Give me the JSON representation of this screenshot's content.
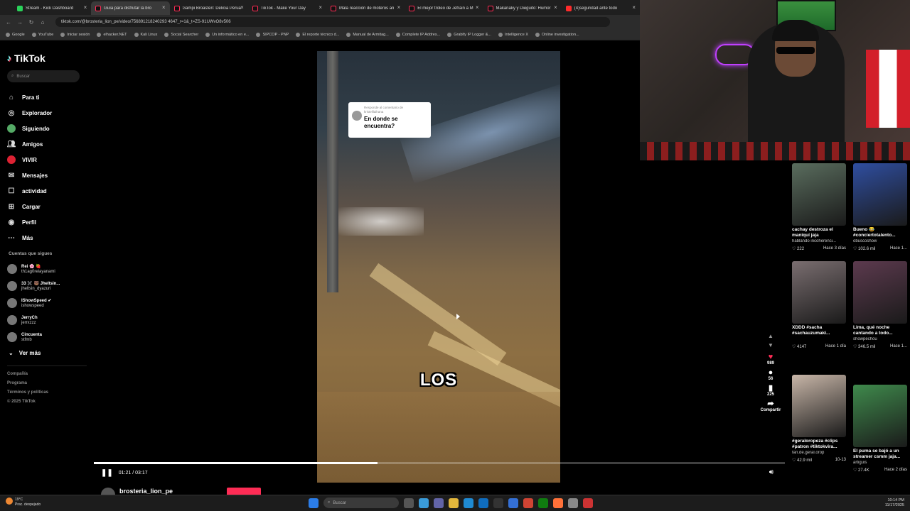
{
  "browser": {
    "tabs": [
      {
        "label": "Stream - Kick Dashboard",
        "active": false,
        "favicon": "kick"
      },
      {
        "label": "Guía para disfrutar la bro",
        "active": true,
        "favicon": "tiktok"
      },
      {
        "label": "Gampi Broasten: Delicia Perua",
        "active": false,
        "favicon": "tiktok"
      },
      {
        "label": "TikTok - Make Your Day",
        "active": false,
        "favicon": "tiktok"
      },
      {
        "label": "Mala reacción de moteros an",
        "active": false,
        "favicon": "tiktok"
      },
      {
        "label": "El mejor troleo de Jefrain a M",
        "active": false,
        "favicon": "tiktok"
      },
      {
        "label": "Makanaky y Dieguito: Humor",
        "active": false,
        "favicon": "tiktok"
      },
      {
        "label": "(4)seguridad ante todo",
        "active": false,
        "favicon": "youtube"
      }
    ],
    "url": "tiktok.com/@brosteria_lion_pe/video/756891218240293 4647_r=1&_t=ZS-91UWvO8v506",
    "bookmarks": [
      "Google",
      "YouTube",
      "Iniciar sesión",
      "elhacker.NET",
      "Kali Linux",
      "Social Searcher",
      "Un informático en e...",
      "SIPCOP - PNP",
      "El reporte técnico d...",
      "Manual de Armitag...",
      "Complete IP Addres...",
      "Grabify IP Logger &...",
      "Intelligence X",
      "Online investigation..."
    ]
  },
  "sidebar": {
    "logo": "TikTok",
    "search_placeholder": "Buscar",
    "menu": [
      {
        "label": "Para ti",
        "icon": "home-icon"
      },
      {
        "label": "Explorador",
        "icon": "compass-icon"
      },
      {
        "label": "Siguiendo",
        "icon": "following-avatar"
      },
      {
        "label": "Amigos",
        "icon": "friends-icon"
      },
      {
        "label": "VIVIR",
        "icon": "live-avatar"
      },
      {
        "label": "Mensajes",
        "icon": "message-icon"
      },
      {
        "label": "actividad",
        "icon": "activity-icon"
      },
      {
        "label": "Cargar",
        "icon": "upload-icon"
      },
      {
        "label": "Perfil",
        "icon": "profile-icon"
      },
      {
        "label": "Más",
        "icon": "more-icon"
      }
    ],
    "following_title": "Cuentas que sigues",
    "following": [
      {
        "name": "Rei 🌸 🍓",
        "handle": "th1ag0reiayanami"
      },
      {
        "name": "33 ✖️ 🐻 Jheltsin...",
        "handle": "jheltsin_dyazuri"
      },
      {
        "name": "IShowSpeed ✔",
        "handle": "ishowspeed"
      },
      {
        "name": "JerryCh",
        "handle": "jerrxzzz"
      },
      {
        "name": "Cincuenta",
        "handle": "stfmb"
      }
    ],
    "see_more": "Ver más",
    "footer": [
      "Compañía",
      "Programa",
      "Términos y políticas",
      "© 2025 TikTok"
    ]
  },
  "video": {
    "comment_reply_label": "Responde al comentario de",
    "comment_author": "kristelllaihana",
    "comment_question": "En donde se encuentra?",
    "caption": "LOS",
    "time": "01:21 / 03:17",
    "progress": 0.41,
    "author": "brosteria_lion_pe"
  },
  "actions": {
    "likes": "989",
    "comments": "56",
    "saves": "225",
    "share": "Compartir"
  },
  "recommendations": [
    {
      "title": "cachay destroza el maniquí jaja",
      "author": "hablando incoherenci...",
      "views": "222",
      "age": "Hace 3 días",
      "thumb": "#5a6d5e"
    },
    {
      "title": "Bueno 😂 #conciertotalento...",
      "author": "obuscoshow",
      "views": "102.6 mil",
      "age": "Hace 1...",
      "thumb": "#2f4ea0"
    },
    {
      "title": "XDDD #sacha #sachauzumaki...",
      "author": "",
      "views": "4147",
      "age": "Hace 1 día",
      "thumb": "#7a6e70"
    },
    {
      "title": "Lima, qué noche cantando a todo...",
      "author": "showpechou",
      "views": "346.5 mil",
      "age": "Hace 1...",
      "thumb": "#5c3a4e"
    },
    {
      "title": "#geraloropeza #clips #patron #tiktokvira...",
      "author": "fan.de.geral.orop",
      "views": "42.9 mil",
      "age": "10-13",
      "thumb": "#c8b6a8"
    },
    {
      "title": "El puma se bajó a un streamer csmm jaja...",
      "author": "artiguis",
      "views": "27.4K",
      "age": "Hace 2 días",
      "thumb": "#3f8a4c"
    }
  ],
  "taskbar": {
    "temp": "19°C",
    "weather": "Prac. despejado",
    "search": "Buscar",
    "time": "10:14 PM",
    "date": "11/17/2025"
  },
  "colors": {
    "accent": "#fe2c55",
    "bg": "#000000"
  }
}
